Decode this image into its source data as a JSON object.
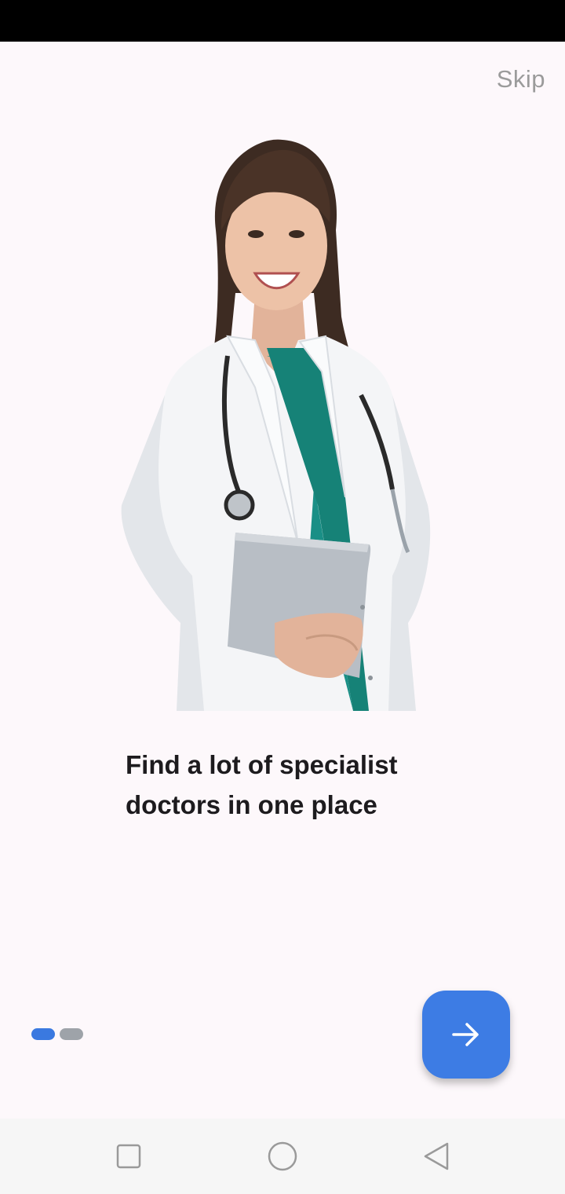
{
  "onboarding": {
    "skip_label": "Skip",
    "headline": "Find a lot of specialist doctors in one place",
    "page_indicator": {
      "current": 1,
      "total": 2
    },
    "next_icon": "arrow-right-icon"
  },
  "colors": {
    "background": "#fdf8fb",
    "accent": "#3d7ce4",
    "indicator_inactive": "#9ea3a9",
    "skip_text": "#9b9b9b"
  },
  "nav_bar": {
    "icons": [
      "square-recents-icon",
      "circle-home-icon",
      "triangle-back-icon"
    ]
  }
}
